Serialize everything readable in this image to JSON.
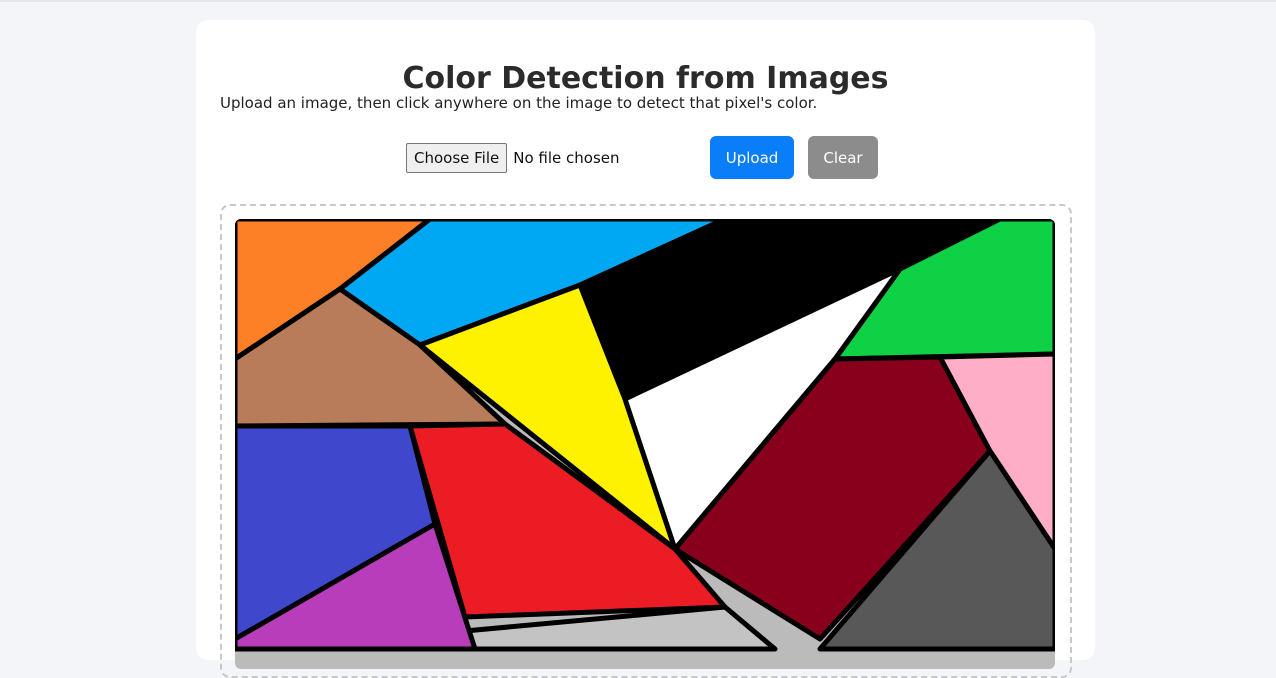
{
  "page": {
    "title": "Color Detection from Images",
    "instructions": "Upload an image, then click anywhere on the image to detect that pixel's color."
  },
  "controls": {
    "file_button_label": "Choose File",
    "file_status": "No file chosen",
    "upload_label": "Upload",
    "clear_label": "Clear"
  },
  "colors": {
    "upload_button": "#0a7df8",
    "clear_button": "#8c8c8c"
  },
  "image_regions": [
    {
      "name": "orange-region",
      "color": "#fd8027"
    },
    {
      "name": "sky-blue-region",
      "color": "#00a8f3"
    },
    {
      "name": "black-region",
      "color": "#000000"
    },
    {
      "name": "green-region",
      "color": "#0ed145"
    },
    {
      "name": "brown-region",
      "color": "#b97c5a"
    },
    {
      "name": "yellow-region",
      "color": "#fff200"
    },
    {
      "name": "white-region",
      "color": "#ffffff"
    },
    {
      "name": "maroon-region",
      "color": "#88001b"
    },
    {
      "name": "pink-region",
      "color": "#ffaec8"
    },
    {
      "name": "indigo-region",
      "color": "#3f48cc"
    },
    {
      "name": "red-region",
      "color": "#ec1c24"
    },
    {
      "name": "purple-region",
      "color": "#b83dba"
    },
    {
      "name": "light-gray-region",
      "color": "#c3c3c3"
    },
    {
      "name": "gray-region",
      "color": "#585858"
    }
  ]
}
